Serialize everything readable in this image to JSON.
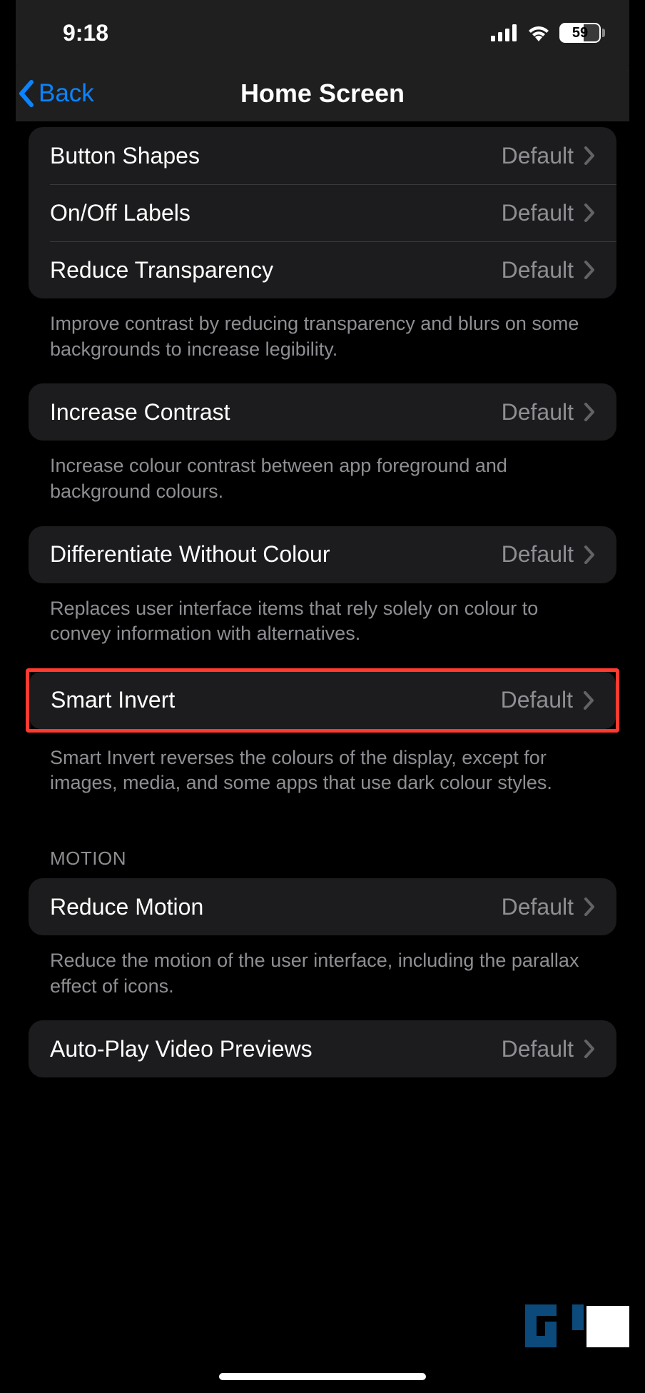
{
  "status": {
    "time": "9:18",
    "battery": "59"
  },
  "nav": {
    "back": "Back",
    "title": "Home Screen"
  },
  "group1": {
    "rows": [
      {
        "label": "Button Shapes",
        "value": "Default"
      },
      {
        "label": "On/Off Labels",
        "value": "Default"
      },
      {
        "label": "Reduce Transparency",
        "value": "Default"
      }
    ],
    "footer": "Improve contrast by reducing transparency and blurs on some backgrounds to increase legibility."
  },
  "group2": {
    "rows": [
      {
        "label": "Increase Contrast",
        "value": "Default"
      }
    ],
    "footer": "Increase colour contrast between app foreground and background colours."
  },
  "group3": {
    "rows": [
      {
        "label": "Differentiate Without Colour",
        "value": "Default"
      }
    ],
    "footer": "Replaces user interface items that rely solely on colour to convey information with alternatives."
  },
  "group4": {
    "rows": [
      {
        "label": "Smart Invert",
        "value": "Default"
      }
    ],
    "footer": "Smart Invert reverses the colours of the display, except for images, media, and some apps that use dark colour styles."
  },
  "motion": {
    "header": "MOTION",
    "rows": [
      {
        "label": "Reduce Motion",
        "value": "Default"
      }
    ],
    "footer": "Reduce the motion of the user interface, including the parallax effect of icons."
  },
  "group6": {
    "rows": [
      {
        "label": "Auto-Play Video Previews",
        "value": "Default"
      }
    ]
  }
}
